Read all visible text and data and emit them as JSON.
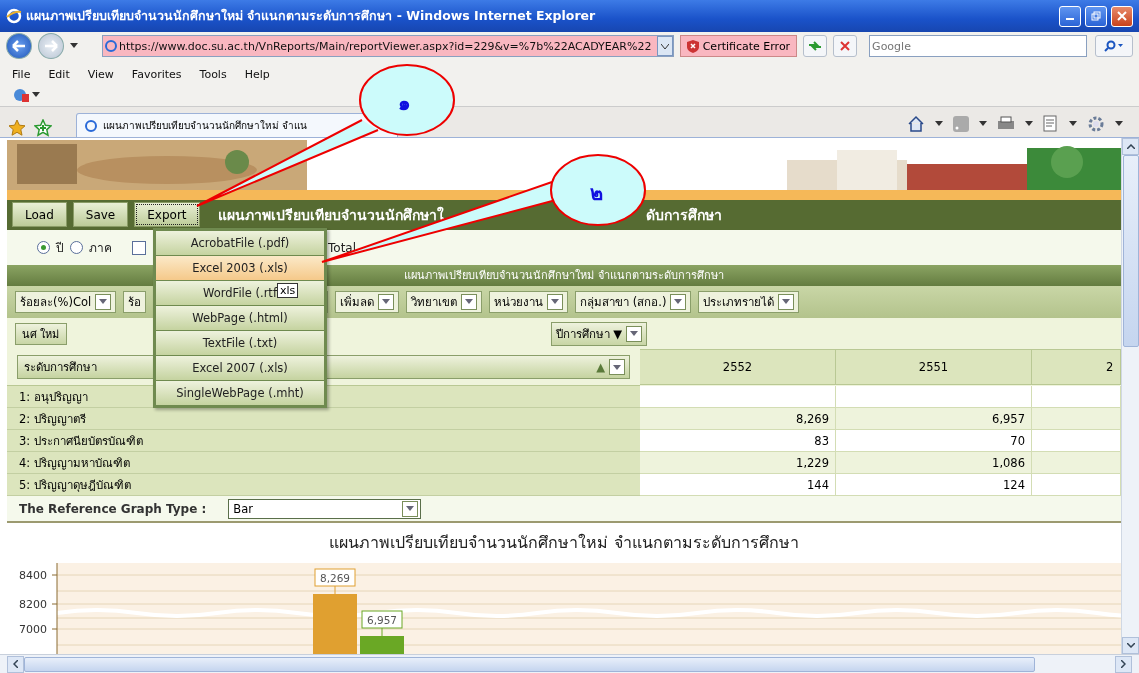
{
  "window": {
    "title": "แผนภาพเปรียบเทียบจำนวนนักศึกษาใหม่ จำแนกตามระดับการศึกษา - Windows Internet Explorer"
  },
  "address_bar": {
    "url": "https://www.doc.su.ac.th/VnReports/Main/reportViewer.aspx?id=229&v=%7b%22ACADYEAR%22",
    "status": "Certificate Error"
  },
  "search": {
    "placeholder": "Google"
  },
  "menu": [
    "File",
    "Edit",
    "View",
    "Favorites",
    "Tools",
    "Help"
  ],
  "tabs": [
    {
      "label": "แผนภาพเปรียบเทียบจำนวนนักศึกษาใหม่ จำแน",
      "selected": true
    }
  ],
  "report": {
    "toolbar_buttons": [
      "Load",
      "Save",
      "Export"
    ],
    "title_parts": [
      "แผนภาพเปรียบเทียบจำนวนนักศึกษาใ",
      "ดับการศึกษา"
    ],
    "period_options": [
      {
        "label": "ปี",
        "selected": true
      },
      {
        "label": "ภาค",
        "selected": false
      }
    ],
    "total": {
      "label": "Total",
      "checked": false
    },
    "header": "แผนภาพเปรียบเทียบจำนวนนักศึกษาใหม่ จำแนกตามระดับการศึกษา",
    "filters": [
      {
        "label": "ร้อยละ(%)Col"
      },
      {
        "label": "ร้อ"
      },
      {
        "kind": "hidden"
      },
      {
        "label": "เพิ่มลด"
      },
      {
        "label": "วิทยาเขต"
      },
      {
        "label": "หน่วยงาน"
      },
      {
        "label": "กลุ่มสาขา (สกอ.)"
      },
      {
        "label": "ประเภทรายได้"
      }
    ],
    "row_field": "นศ ใหม่",
    "column_field": "ปีการศึกษา ▼",
    "row_header": "ระดับการศึกษา",
    "row_header_sort": "▲",
    "columns": [
      "2552",
      "2551",
      "2"
    ],
    "rows": [
      {
        "label": "1: อนุปริญญา",
        "values": []
      },
      {
        "label": "2: ปริญญาตรี",
        "values": [
          "8,269",
          "6,957"
        ]
      },
      {
        "label": "3: ประกาศนียบัตรบัณฑิต",
        "values": [
          "83",
          "70"
        ]
      },
      {
        "label": "4: ปริญญามหาบัณฑิต",
        "values": [
          "1,229",
          "1,086"
        ]
      },
      {
        "label": "5: ปริญญาดุษฎีบัณฑิต",
        "values": [
          "144",
          "124"
        ]
      }
    ],
    "graph_type": {
      "label": "The Reference Graph Type :",
      "value": "Bar"
    },
    "chart": {
      "title": "แผนภาพเปรียบเทียบจำนวนนักศึกษาใหม่ จำแนกตามระดับการศึกษา",
      "axis_labels": [
        "8400",
        "8200",
        "7000"
      ],
      "bars": [
        {
          "label": "8,269",
          "color": "#e0a030"
        },
        {
          "label": "6,957",
          "color": "#6aa825"
        }
      ]
    }
  },
  "export_menu": [
    {
      "label": "AcrobatFile (.pdf)",
      "selected": false
    },
    {
      "label": "Excel 2003 (.xls)",
      "selected": true
    },
    {
      "label": "WordFile (.rtf",
      "selected": false
    },
    {
      "label": "WebPage (.html)",
      "selected": false
    },
    {
      "label": "TextFile (.txt)",
      "selected": false
    },
    {
      "label": "Excel 2007 (.xls)",
      "selected": false
    },
    {
      "label": "SingleWebPage (.mht)",
      "selected": false
    }
  ],
  "tooltip": "xls",
  "callouts": [
    "๑",
    "๒"
  ]
}
